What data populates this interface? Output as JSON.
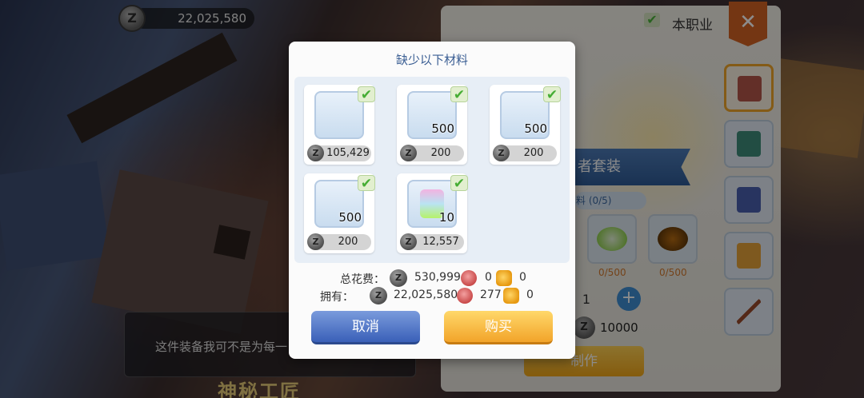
{
  "top_currency": {
    "icon": "zeny-coin-icon",
    "value": "22,025,580"
  },
  "npc_dialog": {
    "text": "这件装备我可不是为每一",
    "speaker": "神秘工匠"
  },
  "craft_panel": {
    "job_filter_label": "本职业",
    "close_label": "✕",
    "set_title": "者套装",
    "set_count": "料 (0/5)",
    "materials": [
      {
        "icon": "flask-icon",
        "need": "0/500"
      },
      {
        "icon": "amber-icon",
        "need": "0/500"
      }
    ],
    "quantity": "1",
    "plus_label": "+",
    "cost": "10000",
    "craft_button": "制作",
    "side_tabs": [
      "costume-icon",
      "cloak-icon",
      "armor-icon",
      "crown-icon",
      "arrow-icon"
    ]
  },
  "modal": {
    "title": "缺少以下材料",
    "items": [
      {
        "icon": "purple-glasses-icon",
        "qty": "",
        "price": "105,429",
        "owned": true
      },
      {
        "icon": "gold-coins-icon",
        "qty": "500",
        "price": "200",
        "owned": true
      },
      {
        "icon": "green-flask-icon",
        "qty": "500",
        "price": "200",
        "owned": true
      },
      {
        "icon": "amber-stone-icon",
        "qty": "500",
        "price": "200",
        "owned": true
      },
      {
        "icon": "rainbow-bottle-icon",
        "qty": "10",
        "price": "12,557",
        "owned": true
      }
    ],
    "total_label": "总花费：",
    "total_zeny": "530,999",
    "total_red": "0",
    "total_gold": "0",
    "owned_label": "拥有：",
    "owned_zeny": "22,025,580",
    "owned_red": "277",
    "owned_gold": "0",
    "cancel_label": "取消",
    "buy_label": "购买"
  }
}
